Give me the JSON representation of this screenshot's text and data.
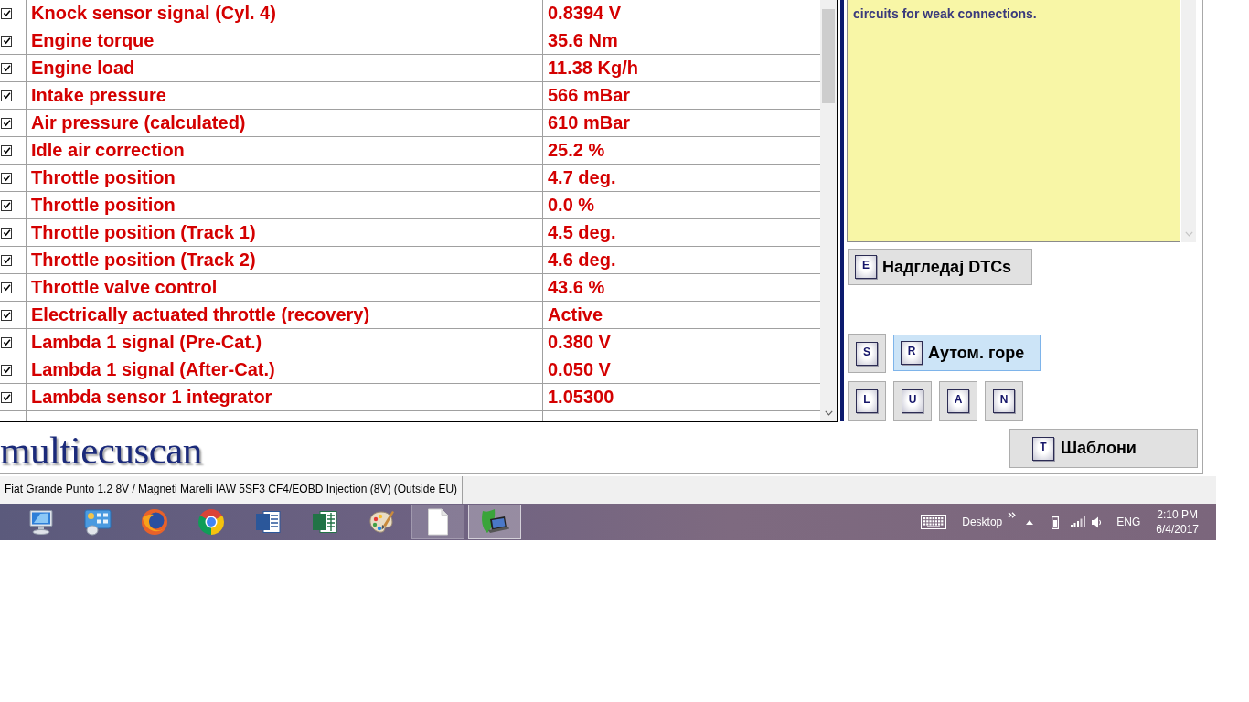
{
  "parameters": [
    {
      "checked": true,
      "name": "Knock sensor signal (Cyl. 4)",
      "value": "0.8394 V"
    },
    {
      "checked": true,
      "name": "Engine torque",
      "value": "35.6 Nm"
    },
    {
      "checked": true,
      "name": "Engine load",
      "value": "11.38 Kg/h"
    },
    {
      "checked": true,
      "name": "Intake pressure",
      "value": "566 mBar"
    },
    {
      "checked": true,
      "name": "Air pressure (calculated)",
      "value": "610 mBar"
    },
    {
      "checked": true,
      "name": "Idle air correction",
      "value": "25.2 %"
    },
    {
      "checked": true,
      "name": "Throttle position",
      "value": "4.7 deg."
    },
    {
      "checked": true,
      "name": "Throttle position",
      "value": "0.0 %"
    },
    {
      "checked": true,
      "name": "Throttle position (Track 1)",
      "value": "4.5 deg."
    },
    {
      "checked": true,
      "name": "Throttle position (Track 2)",
      "value": "4.6 deg."
    },
    {
      "checked": true,
      "name": "Throttle valve control",
      "value": "43.6 %"
    },
    {
      "checked": true,
      "name": "Electrically actuated throttle (recovery)",
      "value": "Active"
    },
    {
      "checked": true,
      "name": "Lambda 1 signal (Pre-Cat.)",
      "value": "0.380 V"
    },
    {
      "checked": true,
      "name": "Lambda 1 signal (After-Cat.)",
      "value": "0.050 V"
    },
    {
      "checked": true,
      "name": "Lambda sensor 1 integrator",
      "value": "1.05300"
    }
  ],
  "message": {
    "text": "circuits for weak connections."
  },
  "dtc_button": {
    "key": "E",
    "label": "Надгледај DTCs"
  },
  "view_buttons": [
    {
      "key": "S",
      "highlighted": false
    },
    {
      "key": "R",
      "label": "Аутом. горе",
      "highlighted": true
    }
  ],
  "letter_buttons": [
    {
      "key": "L"
    },
    {
      "key": "U"
    },
    {
      "key": "A"
    },
    {
      "key": "N"
    }
  ],
  "templates_button": {
    "key": "T",
    "label": "Шаблони"
  },
  "logo": {
    "text": "multiecuscan"
  },
  "status_bar": {
    "text": "Fiat Grande Punto 1.2 8V / Magneti Marelli IAW 5SF3 CF4/EOBD Injection (8V) (Outside EU)"
  },
  "taskbar": {
    "items": [
      {
        "running": false,
        "selected": false
      },
      {
        "running": false,
        "selected": false
      },
      {
        "running": false,
        "selected": false
      },
      {
        "running": false,
        "selected": false
      },
      {
        "running": false,
        "selected": false
      },
      {
        "running": false,
        "selected": false
      },
      {
        "running": false,
        "selected": false
      },
      {
        "running": true,
        "selected": false
      },
      {
        "running": true,
        "selected": true
      }
    ],
    "tray": {
      "toolbar_label": "Desktop",
      "language": "ENG",
      "time": "2:10 PM",
      "date": "6/4/2017"
    }
  }
}
